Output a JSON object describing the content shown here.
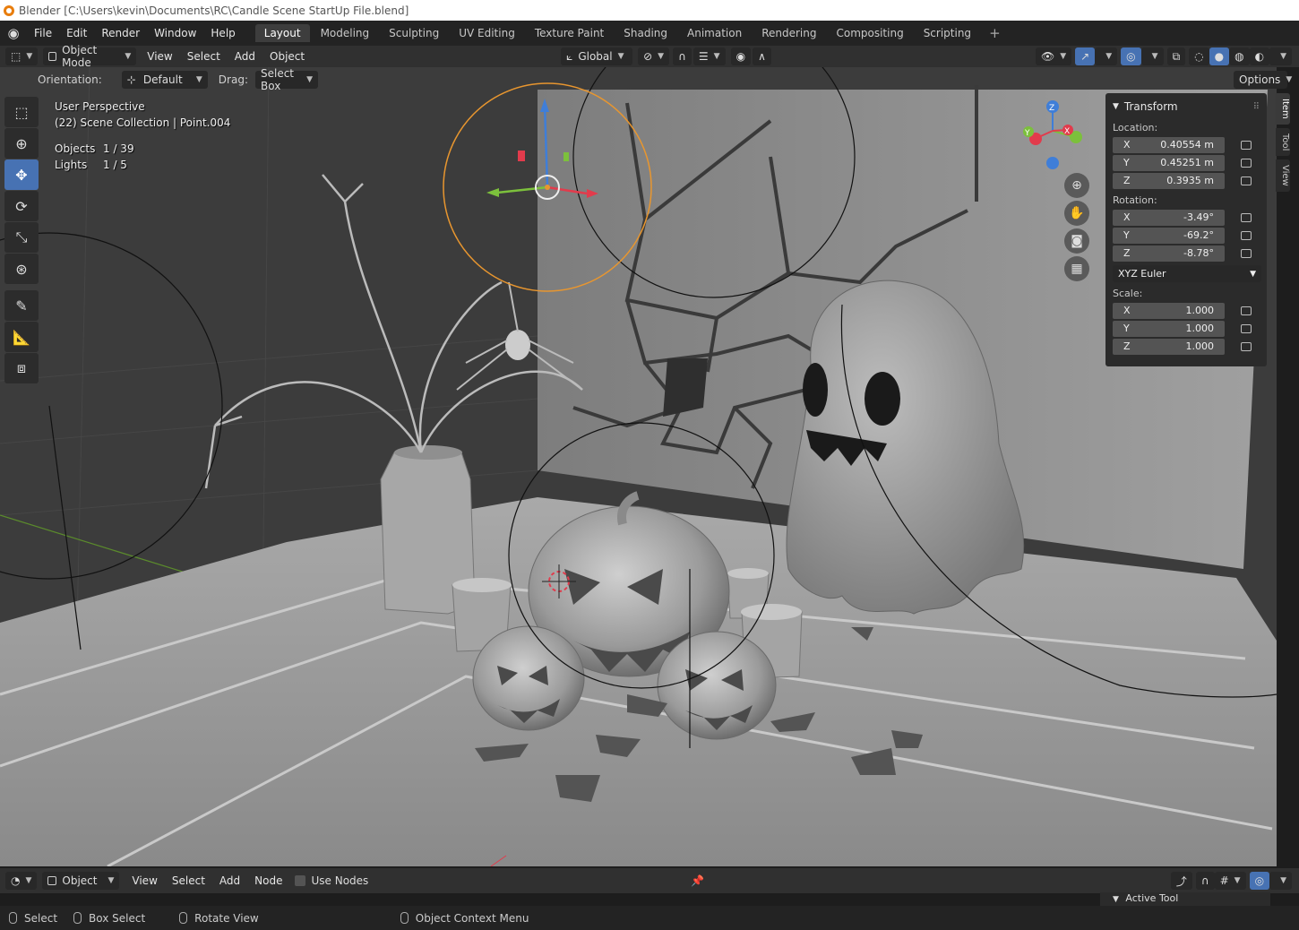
{
  "window": {
    "title": "Blender [C:\\Users\\kevin\\Documents\\RC\\Candle Scene StartUp File.blend]"
  },
  "menubar": {
    "menus": [
      "File",
      "Edit",
      "Render",
      "Window",
      "Help"
    ],
    "workspaces": [
      "Layout",
      "Modeling",
      "Sculpting",
      "UV Editing",
      "Texture Paint",
      "Shading",
      "Animation",
      "Rendering",
      "Compositing",
      "Scripting"
    ],
    "active_workspace": "Layout",
    "add_workspace": "+"
  },
  "viewport_header": {
    "mode": "Object Mode",
    "menus": [
      "View",
      "Select",
      "Add",
      "Object"
    ],
    "transform_orientation": "Global"
  },
  "tool_options": {
    "orientation_label": "Orientation:",
    "orientation_value": "Default",
    "drag_label": "Drag:",
    "drag_value": "Select Box",
    "options_label": "Options"
  },
  "overlay": {
    "perspective": "User Perspective",
    "collection": "(22) Scene Collection | Point.004",
    "stats": [
      {
        "label": "Objects",
        "value": "1 / 39"
      },
      {
        "label": "Lights",
        "value": "1 / 5"
      }
    ]
  },
  "gizmo": {
    "x": "X",
    "y": "Y",
    "z": "Z"
  },
  "npanel": {
    "title": "Transform",
    "location_label": "Location:",
    "location": [
      {
        "axis": "X",
        "value": "0.40554 m"
      },
      {
        "axis": "Y",
        "value": "0.45251 m"
      },
      {
        "axis": "Z",
        "value": "0.3935 m"
      }
    ],
    "rotation_label": "Rotation:",
    "rotation": [
      {
        "axis": "X",
        "value": "-3.49°"
      },
      {
        "axis": "Y",
        "value": "-69.2°"
      },
      {
        "axis": "Z",
        "value": "-8.78°"
      }
    ],
    "rotation_mode": "XYZ Euler",
    "scale_label": "Scale:",
    "scale": [
      {
        "axis": "X",
        "value": "1.000"
      },
      {
        "axis": "Y",
        "value": "1.000"
      },
      {
        "axis": "Z",
        "value": "1.000"
      }
    ],
    "side_tabs": [
      "Item",
      "Tool",
      "View"
    ]
  },
  "node_header": {
    "type": "Object",
    "menus": [
      "View",
      "Select",
      "Add",
      "Node"
    ],
    "use_nodes_label": "Use Nodes",
    "active_tool_label": "Active Tool"
  },
  "statusbar": {
    "items": [
      "Select",
      "Box Select",
      "Rotate View",
      "Object Context Menu"
    ]
  },
  "colors": {
    "accent_blue": "#4772b3",
    "selection_orange": "#e8962f",
    "axis_x": "#e23b4c",
    "axis_y": "#7cc03c",
    "axis_z": "#3f7ed8"
  }
}
